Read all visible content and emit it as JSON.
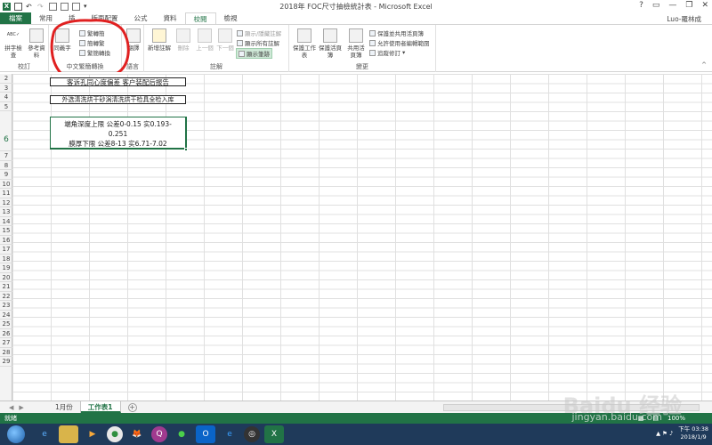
{
  "window": {
    "title": "2018年 FOC尺寸抽檢統計表 - Microsoft Excel",
    "minimize": "—",
    "restore": "❐",
    "close": "✕"
  },
  "tabs": [
    {
      "label": "檔案"
    },
    {
      "label": "常用"
    },
    {
      "label": "插"
    },
    {
      "label": "版面配置"
    },
    {
      "label": "公式"
    },
    {
      "label": "資料"
    },
    {
      "label": "校閱"
    },
    {
      "label": "檢視"
    }
  ],
  "active_tab": "校閱",
  "user": "Luo-羅林成",
  "ribbon": {
    "groups": {
      "proofing": "校訂",
      "chinese": "中文繁簡轉換",
      "language": "語言",
      "comments": "註解",
      "changes": "變更"
    },
    "buttons": {
      "spelling": "拼字檢查",
      "research": "參考資料",
      "thesaurus": "同義字",
      "trad_to_simp": "繁轉簡",
      "simp_to_trad": "簡轉繁",
      "convert": "繁簡轉換",
      "translate": "翻譯",
      "new_comment": "新增註解",
      "delete": "刪除",
      "previous": "上一個",
      "next": "下一個",
      "show_hide_comment": "顯示/隱藏註解",
      "show_all_comments": "顯示所有註解",
      "show_ink": "顯示筆跡",
      "protect_sheet": "保護工作表",
      "protect_workbook": "保護活頁簿",
      "share_workbook": "共用活頁簿",
      "protect_share": "保護並共用活頁簿",
      "allow_edit_ranges": "允許使用者編輯範圍",
      "track_changes": "追蹤修訂"
    }
  },
  "rows": [
    "2",
    "3",
    "4",
    "5",
    "6",
    "7",
    "8",
    "9",
    "10",
    "11",
    "12",
    "13",
    "14",
    "15",
    "16",
    "17",
    "18",
    "19",
    "20",
    "21",
    "22",
    "23",
    "24",
    "25",
    "26",
    "27",
    "28",
    "29"
  ],
  "cells": {
    "c2": "客诉孔同心度偏差 客户装配后报告",
    "c4": "外选清洗烘干砂涡清洗烘干检具全检入库",
    "c6_line1": "端角深度上限 公差0-0.15  实0.193-",
    "c6_line2": "0.251",
    "c6_line3": "膜厚下限 公差8-13  实6.71-7.02"
  },
  "sheets": [
    {
      "label": "1月份"
    },
    {
      "label": "工作表1"
    }
  ],
  "active_sheet": "工作表1",
  "status": {
    "left": "就緒",
    "zoom": "100%"
  },
  "taskbar": {
    "time": "下午 03:38",
    "date": "2018/1/9"
  },
  "watermark": {
    "brand": "Baidu 经验",
    "url": "jingyan.baidu.com"
  },
  "colors": {
    "excel_green": "#217346",
    "annotation_red": "#e02020",
    "taskbar": "#1f3a5a"
  }
}
